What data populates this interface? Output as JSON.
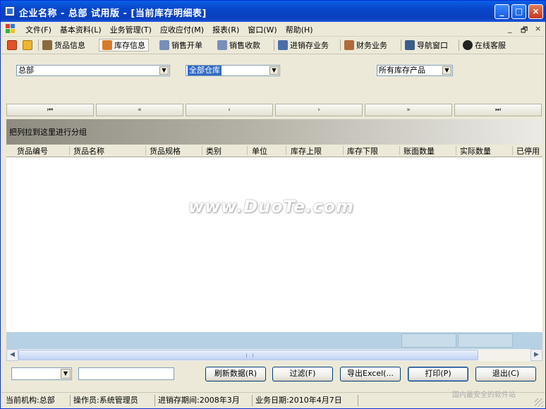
{
  "window": {
    "title": "企业名称 - 总部  试用版 - [当前库存明细表]",
    "controls": {
      "minimize": "_",
      "maximize": "□",
      "close": "×"
    }
  },
  "menu": {
    "items": [
      "文件(F)",
      "基本资料(L)",
      "业务管理(T)",
      "应收应付(M)",
      "报表(R)",
      "窗口(W)",
      "帮助(H)"
    ],
    "mdi_controls": {
      "minimize": "_",
      "restore": "🗗",
      "close": "×"
    }
  },
  "toolbar": {
    "items": [
      {
        "label": "货品信息",
        "icon": "goods-icon",
        "color": "#8b6a3e"
      },
      {
        "label": "库存信息",
        "icon": "house-icon",
        "color": "#d97a2b"
      },
      {
        "label": "销售开单",
        "icon": "document-icon",
        "color": "#7a8fb8"
      },
      {
        "label": "销售收款",
        "icon": "document-icon",
        "color": "#7a8fb8"
      },
      {
        "label": "进销存业务",
        "icon": "ledger-icon",
        "color": "#4a6ea8"
      },
      {
        "label": "财务业务",
        "icon": "book-icon",
        "color": "#b06a3a"
      },
      {
        "label": "导航窗口",
        "icon": "navigator-icon",
        "color": "#3a5c8a"
      },
      {
        "label": "在线客服",
        "icon": "qq-icon",
        "color": "#222222"
      }
    ]
  },
  "filters": {
    "org": "总部",
    "warehouse": "全部仓库",
    "products": "所有库存产品"
  },
  "nav": {
    "first": "⏮",
    "prev_page": "«",
    "prev": "‹",
    "next": "›",
    "next_page": "»",
    "last": "⏭"
  },
  "grid": {
    "group_prompt": "把列拉到这里进行分组",
    "columns": [
      "货品编号",
      "货品名称",
      "货品规格",
      "类别",
      "单位",
      "库存上限",
      "库存下限",
      "账面数量",
      "实际数量",
      "已停用"
    ],
    "watermark": "www.DuoTe.com"
  },
  "bottom": {
    "refresh": "刷新数据(R)",
    "filter": "过滤(F)",
    "export": "导出Excel(...",
    "print": "打印(P)",
    "exit": "退出(C)"
  },
  "status": {
    "org": "当前机构:总部",
    "operator": "操作员:系统管理员",
    "period": "进销存期间:2008年3月",
    "business_date": "业务日期:2010年4月7日"
  },
  "corner_watermark": "国内最安全的软件站",
  "colors": {
    "titlebar": "#0a4fd6",
    "selection": "#316ac5",
    "summary": "#b5d1e3"
  }
}
